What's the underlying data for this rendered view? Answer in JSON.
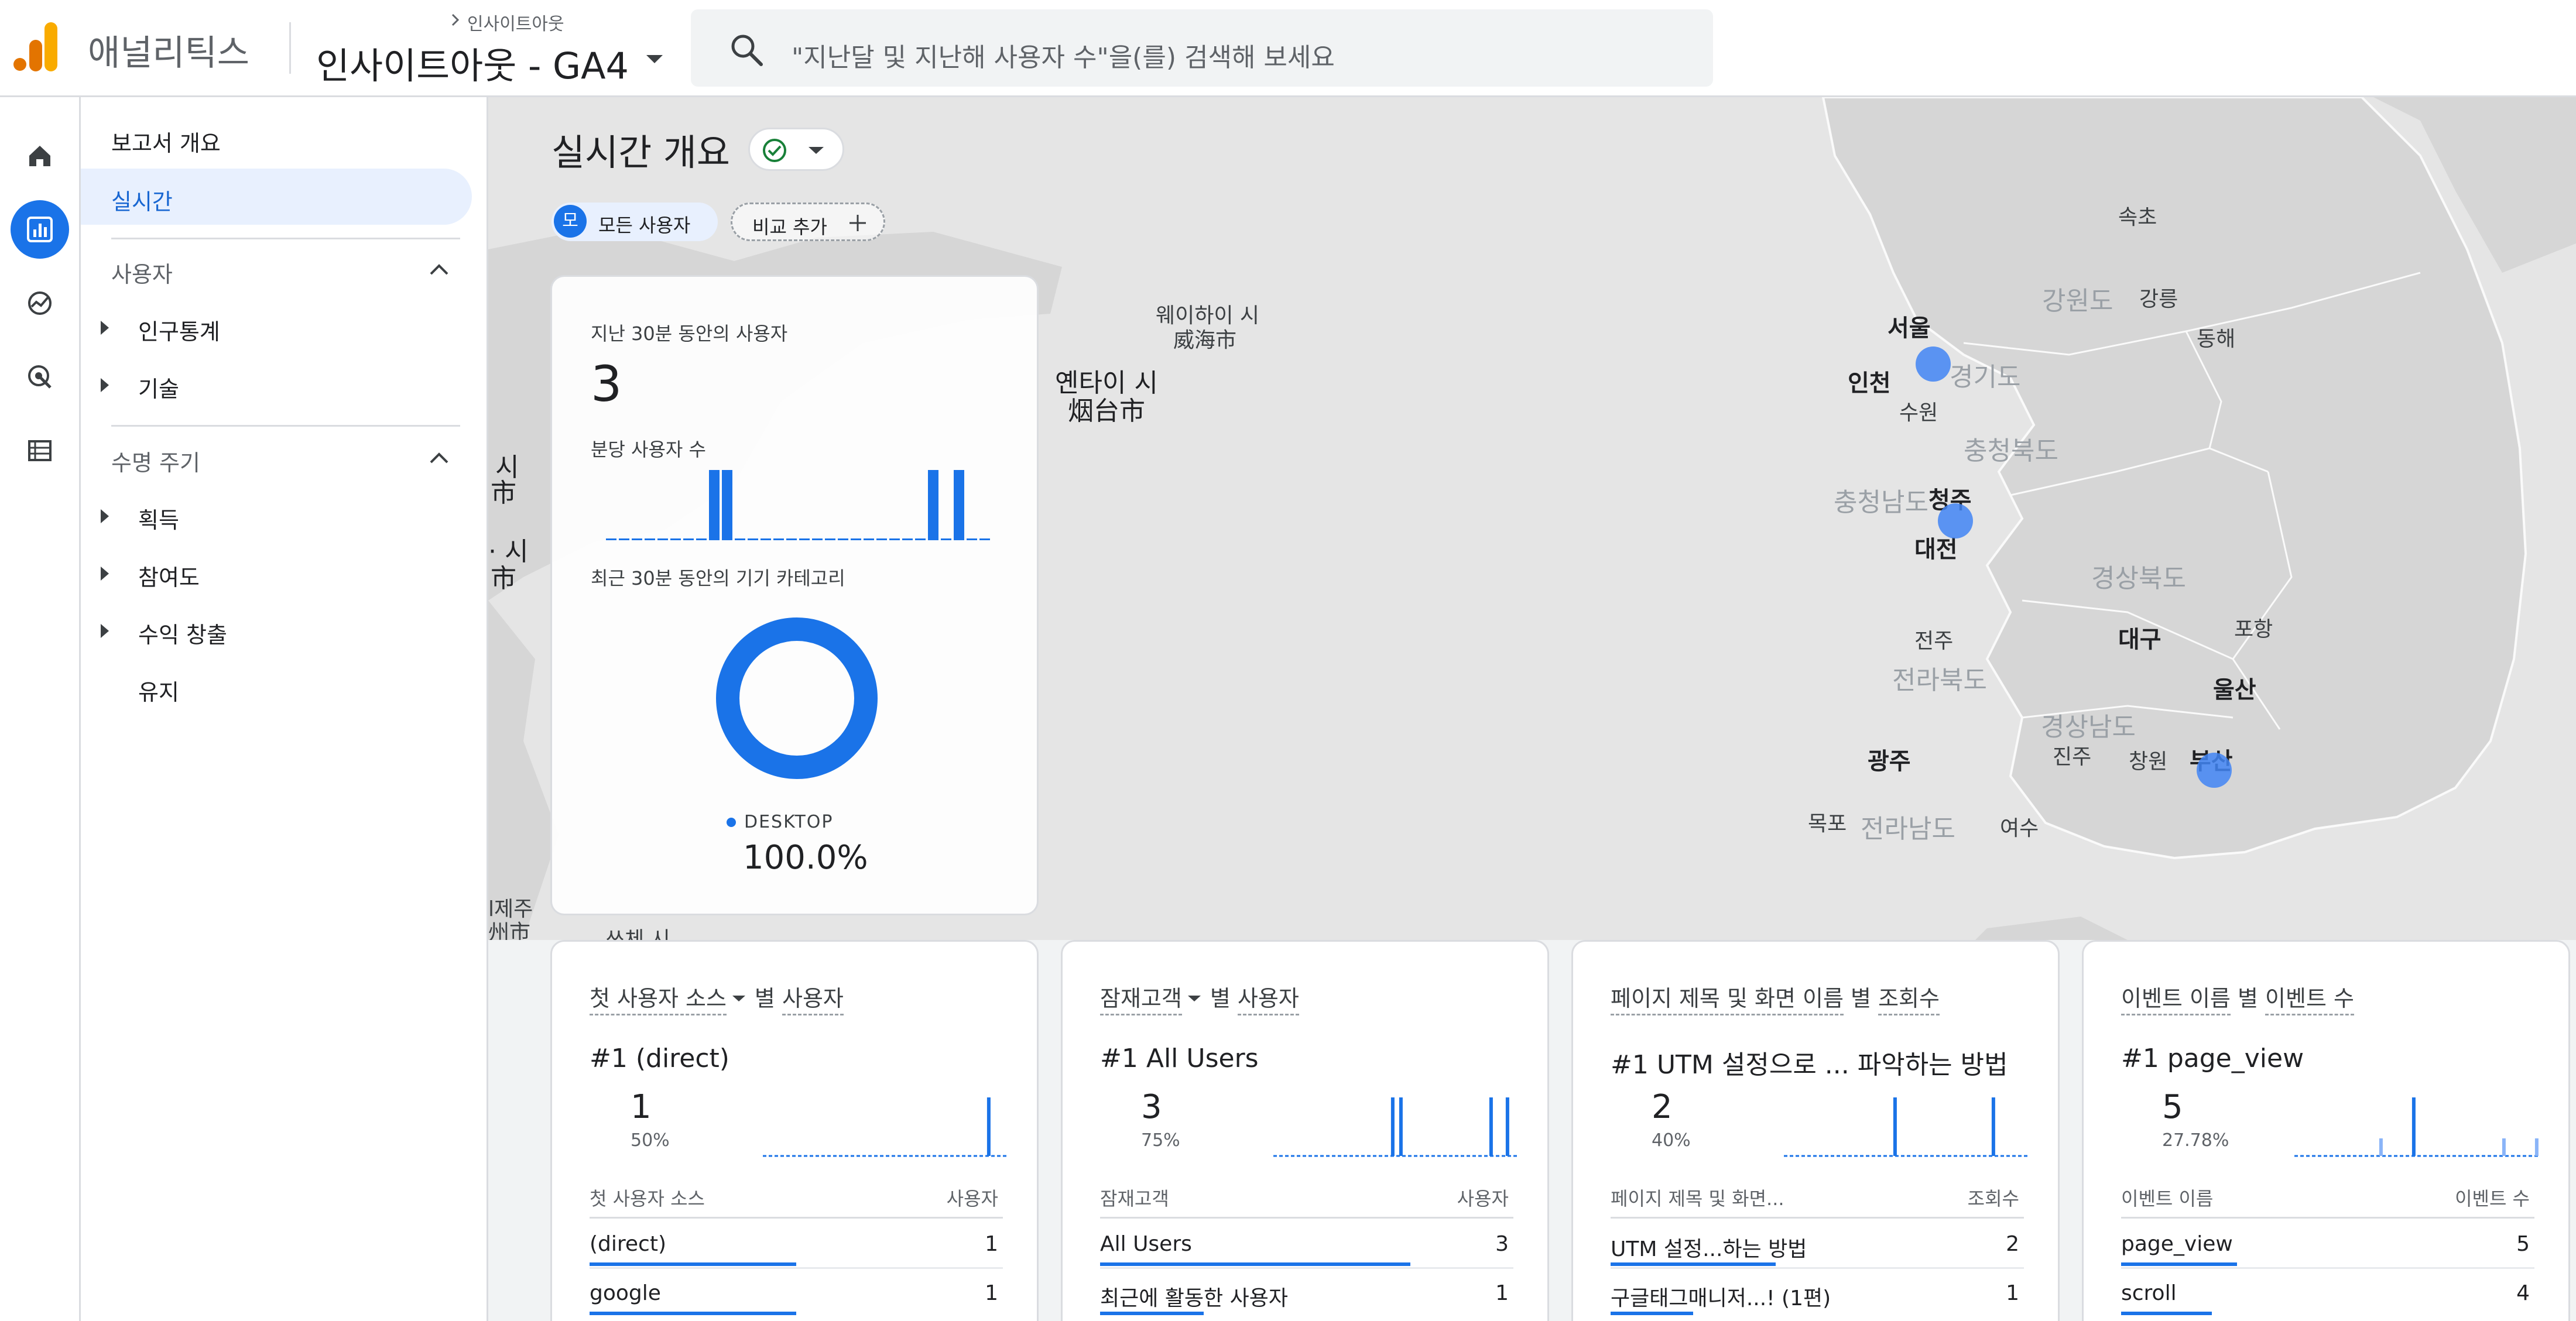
{
  "header": {
    "product_name": "애널리틱스",
    "account_breadcrumb": "인사이트아웃",
    "property_name": "인사이트아웃 - GA4",
    "search_placeholder": "\"지난달 및 지난해 사용자 수\"을(를) 검색해 보세요"
  },
  "rail": {
    "items": [
      {
        "icon": "home-icon"
      },
      {
        "icon": "reports-icon",
        "active": true
      },
      {
        "icon": "explore-icon"
      },
      {
        "icon": "advertising-icon"
      },
      {
        "icon": "configure-icon"
      }
    ]
  },
  "nav": {
    "overview": "보고서 개요",
    "realtime": "실시간",
    "section_user": "사용자",
    "demographics": "인구통계",
    "tech": "기술",
    "section_lifecycle": "수명 주기",
    "acquisition": "획득",
    "engagement": "참여도",
    "monetization": "수익 창출",
    "retention": "유지"
  },
  "page": {
    "title": "실시간 개요",
    "status_color": "#188038",
    "chip_all_avatar": "모",
    "chip_all_label": "모든 사용자",
    "chip_compare_label": "비교 추가"
  },
  "map": {
    "labels": {
      "weihai": "웨이하이 시",
      "weihai_cn": "威海市",
      "yantai": "옌타이 시",
      "yantai_cn": "烟台市",
      "seoul": "서울",
      "incheon": "인천",
      "suwon": "수원",
      "gyeonggi": "경기도",
      "gangwon": "강원도",
      "sokcho": "속초",
      "gangneung": "강릉",
      "donghae": "동해",
      "chungbuk": "충청북도",
      "chungnam": "충청남도",
      "cheongju": "청주",
      "daejeon": "대전",
      "gyeongbuk": "경상북도",
      "pohang": "포항",
      "daegu": "대구",
      "jeonju": "전주",
      "jeonbuk": "전라북도",
      "ulsan": "울산",
      "gyeongnam": "경상남도",
      "gwangju": "광주",
      "jinju": "진주",
      "changwon": "창원",
      "busan": "부산",
      "mokpo": "목포",
      "jeonnam": "전라남도",
      "yeosu": "여수",
      "jeju_partial": "l제주",
      "jeju_cn_partial": "州市",
      "si_partial_1": "시",
      "si_cn_partial_1": "市",
      "si_partial_2": "· 시",
      "si_cn_partial_2": "市",
      "bottom_partial": "쓰체 시"
    }
  },
  "realtime_card": {
    "users_30min_label": "지난 30분 동안의 사용자",
    "users_30min_value": "3",
    "per_minute_label": "분당 사용자 수",
    "per_minute_values": [
      0,
      0,
      0,
      0,
      0,
      0,
      0,
      0,
      1,
      1,
      0,
      0,
      0,
      0,
      0,
      0,
      0,
      0,
      0,
      0,
      0,
      0,
      0,
      0,
      0,
      1,
      0,
      1,
      0,
      0
    ],
    "device_label": "최근 30분 동안의 기기 카테고리",
    "device_legend": "DESKTOP",
    "device_pct": "100.0%",
    "device_share": 1.0
  },
  "cards": [
    {
      "title_dim": "첫 사용자 소스",
      "title_mid": "별",
      "title_metric": "사용자",
      "has_dropdown": true,
      "top_rank": "#1 (direct)",
      "top_value": "1",
      "top_pct": "50%",
      "spark": [
        0,
        0,
        0,
        0,
        0,
        0,
        0,
        0,
        0,
        0,
        0,
        0,
        0,
        0,
        0,
        0,
        0,
        0,
        0,
        0,
        0,
        0,
        0,
        0,
        0,
        0,
        0,
        1,
        0,
        0
      ],
      "col_dim": "첫 사용자 소스",
      "col_metric": "사용자",
      "rows": [
        {
          "name": "(direct)",
          "value": "1",
          "share": 0.5
        },
        {
          "name": "google",
          "value": "1",
          "share": 0.5
        }
      ]
    },
    {
      "title_dim": "잠재고객",
      "title_mid": "별",
      "title_metric": "사용자",
      "has_dropdown": true,
      "top_rank": "#1 All Users",
      "top_value": "3",
      "top_pct": "75%",
      "spark": [
        0,
        0,
        0,
        0,
        0,
        0,
        0,
        0,
        0,
        0,
        0,
        0,
        0,
        0,
        1,
        1,
        0,
        0,
        0,
        0,
        0,
        0,
        0,
        0,
        0,
        0,
        1,
        0,
        1,
        0
      ],
      "col_dim": "잠재고객",
      "col_metric": "사용자",
      "rows": [
        {
          "name": "All Users",
          "value": "3",
          "share": 0.75
        },
        {
          "name": "최근에 활동한 사용자",
          "value": "1",
          "share": 0.25
        }
      ]
    },
    {
      "title_dim": "페이지 제목 및 화면 이름",
      "title_mid": "별",
      "title_metric": "조회수",
      "has_dropdown": false,
      "top_rank": "#1 UTM 설정으로 ... 파악하는 방법",
      "top_value": "2",
      "top_pct": "40%",
      "spark": [
        0,
        0,
        0,
        0,
        0,
        0,
        0,
        0,
        0,
        0,
        0,
        0,
        0,
        1,
        0,
        0,
        0,
        0,
        0,
        0,
        0,
        0,
        0,
        0,
        0,
        1,
        0,
        0,
        0,
        0
      ],
      "col_dim": "페이지 제목 및 화면...",
      "col_metric": "조회수",
      "rows": [
        {
          "name": "UTM 설정...하는 방법",
          "value": "2",
          "share": 0.4
        },
        {
          "name": "구글태그매니저...! (1편)",
          "value": "1",
          "share": 0.2
        }
      ]
    },
    {
      "title_dim": "이벤트 이름",
      "title_mid": "별",
      "title_metric": "이벤트 수",
      "has_dropdown": false,
      "top_rank": "#1 page_view",
      "top_value": "5",
      "top_pct": "27.78%",
      "spark": [
        0,
        0,
        0,
        0,
        0,
        0,
        0,
        0,
        0,
        0,
        0.3,
        0,
        0,
        0,
        1,
        0,
        0,
        0,
        0,
        0,
        0,
        0,
        0,
        0,
        0,
        0.3,
        0,
        0,
        0,
        0.3
      ],
      "col_dim": "이벤트 이름",
      "col_metric": "이벤트 수",
      "rows": [
        {
          "name": "page_view",
          "value": "5",
          "share": 0.28
        },
        {
          "name": "scroll",
          "value": "4",
          "share": 0.22
        }
      ]
    }
  ]
}
